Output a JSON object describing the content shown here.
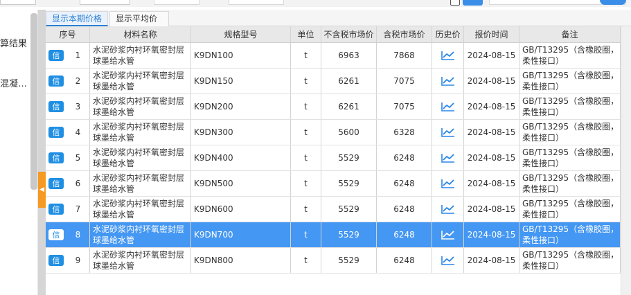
{
  "left_panel": {
    "items": [
      "算结果",
      "混凝…"
    ]
  },
  "tabs": {
    "active": "显示本期价格",
    "second": "显示平均价"
  },
  "table": {
    "headers": {
      "seq": "序号",
      "name": "材料名称",
      "spec": "规格型号",
      "unit": "单位",
      "excl_tax": "不含税市场价",
      "incl_tax": "含税市场价",
      "history": "历史价",
      "quote_time": "报价时间",
      "remark": "备注"
    },
    "badge_label": "信",
    "rows": [
      {
        "seq": "1",
        "name": "水泥砂浆内衬环氧密封层球墨给水管",
        "spec": "K9DN100",
        "unit": "t",
        "excl_tax": "6963",
        "incl_tax": "7868",
        "quote_time": "2024-08-15",
        "remark": "GB/T13295（含橡胶圈，柔性接口）",
        "selected": false
      },
      {
        "seq": "2",
        "name": "水泥砂浆内衬环氧密封层球墨给水管",
        "spec": "K9DN150",
        "unit": "t",
        "excl_tax": "6261",
        "incl_tax": "7075",
        "quote_time": "2024-08-15",
        "remark": "GB/T13295（含橡胶圈，柔性接口）",
        "selected": false
      },
      {
        "seq": "3",
        "name": "水泥砂浆内衬环氧密封层球墨给水管",
        "spec": "K9DN200",
        "unit": "t",
        "excl_tax": "6261",
        "incl_tax": "7075",
        "quote_time": "2024-08-15",
        "remark": "GB/T13295（含橡胶圈，柔性接口）",
        "selected": false
      },
      {
        "seq": "4",
        "name": "水泥砂浆内衬环氧密封层球墨给水管",
        "spec": "K9DN300",
        "unit": "t",
        "excl_tax": "5600",
        "incl_tax": "6328",
        "quote_time": "2024-08-15",
        "remark": "GB/T13295（含橡胶圈，柔性接口）",
        "selected": false
      },
      {
        "seq": "5",
        "name": "水泥砂浆内衬环氧密封层球墨给水管",
        "spec": "K9DN400",
        "unit": "t",
        "excl_tax": "5529",
        "incl_tax": "6248",
        "quote_time": "2024-08-15",
        "remark": "GB/T13295（含橡胶圈，柔性接口）",
        "selected": false
      },
      {
        "seq": "6",
        "name": "水泥砂浆内衬环氧密封层球墨给水管",
        "spec": "K9DN500",
        "unit": "t",
        "excl_tax": "5529",
        "incl_tax": "6248",
        "quote_time": "2024-08-15",
        "remark": "GB/T13295（含橡胶圈，柔性接口）",
        "selected": false
      },
      {
        "seq": "7",
        "name": "水泥砂浆内衬环氧密封层球墨给水管",
        "spec": "K9DN600",
        "unit": "t",
        "excl_tax": "5529",
        "incl_tax": "6248",
        "quote_time": "2024-08-15",
        "remark": "GB/T13295（含橡胶圈，柔性接口）",
        "selected": false
      },
      {
        "seq": "8",
        "name": "水泥砂浆内衬环氧密封层球墨给水管",
        "spec": "K9DN700",
        "unit": "t",
        "excl_tax": "5529",
        "incl_tax": "6248",
        "quote_time": "2024-08-15",
        "remark": "GB/T13295（含橡胶圈，柔性接口）",
        "selected": true
      },
      {
        "seq": "9",
        "name": "水泥砂浆内衬环氧密封层球墨给水管",
        "spec": "K9DN800",
        "unit": "t",
        "excl_tax": "5529",
        "incl_tax": "6248",
        "quote_time": "2024-08-15",
        "remark": "GB/T13295（含橡胶圈，柔性接口）",
        "selected": false
      }
    ]
  },
  "icons": {
    "history": "trend-chart-icon",
    "collapse": "chevron-left-icon",
    "search": "search-icon"
  },
  "colors": {
    "accent": "#2a7fd4",
    "selected_row": "#4497f2",
    "badge": "#1f8fe3",
    "collapse_handle": "#f59a23"
  }
}
